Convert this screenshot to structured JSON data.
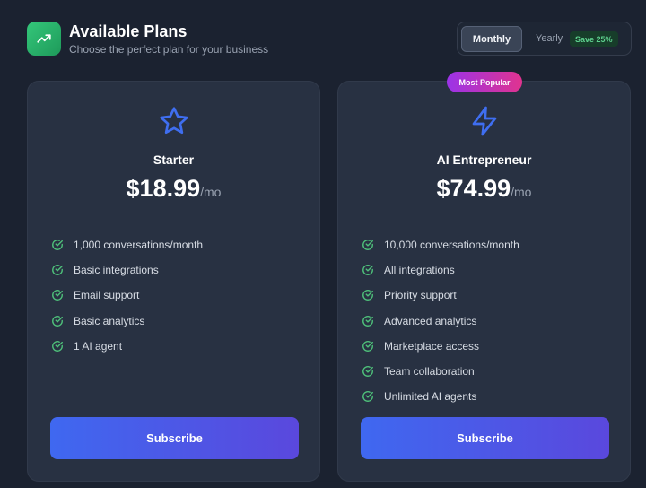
{
  "header": {
    "title": "Available Plans",
    "subtitle": "Choose the perfect plan for your business",
    "icon": "trending-up-icon"
  },
  "billing_toggle": {
    "monthly_label": "Monthly",
    "yearly_label": "Yearly",
    "save_badge": "Save 25%",
    "selected": "Monthly"
  },
  "plans": [
    {
      "name": "Starter",
      "price": "$18.99",
      "period": "/mo",
      "icon": "star-icon",
      "features": [
        "1,000 conversations/month",
        "Basic integrations",
        "Email support",
        "Basic analytics",
        "1 AI agent"
      ],
      "cta": "Subscribe"
    },
    {
      "name": "AI Entrepreneur",
      "price": "$74.99",
      "period": "/mo",
      "icon": "lightning-icon",
      "badge": "Most Popular",
      "features": [
        "10,000 conversations/month",
        "All integrations",
        "Priority support",
        "Advanced analytics",
        "Marketplace access",
        "Team collaboration",
        "Unlimited AI agents"
      ],
      "cta": "Subscribe"
    }
  ],
  "colors": {
    "background": "#1b2230",
    "card": "#283142",
    "accent_blue": "#3f68f0",
    "accent_purple": "#5a48dd",
    "check_green": "#4ec07a",
    "brand_green": "#34c77a",
    "badge_pink": "#e0338f"
  }
}
